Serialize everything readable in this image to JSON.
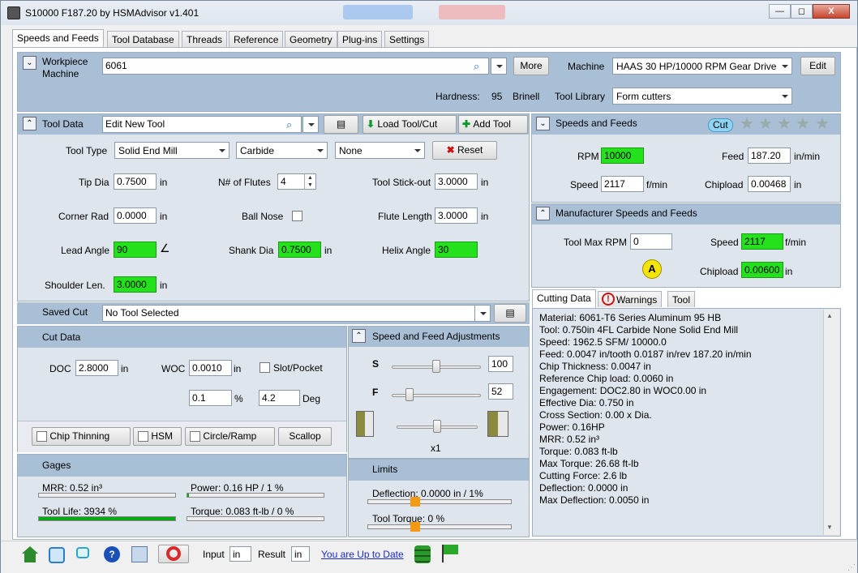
{
  "window": {
    "title": "S10000 F187.20 by HSMAdvisor v1.401",
    "min": "—",
    "restore": "◻",
    "close": "X"
  },
  "tabs": [
    "Speeds and Feeds",
    "Tool Database",
    "Threads",
    "Reference",
    "Geometry",
    "Plug-ins",
    "Settings"
  ],
  "workpiece": {
    "label1": "Workpiece",
    "label2": "Machine",
    "material": "6061",
    "more": "More",
    "machine_label": "Machine",
    "machine_value": "HAAS 30 HP/10000 RPM Gear Drive",
    "edit": "Edit",
    "hardness_label": "Hardness:",
    "hardness_value": "95",
    "hardness_unit": "Brinell",
    "tool_library_label": "Tool Library",
    "tool_library_value": "Form cutters"
  },
  "tool_data": {
    "header": "Tool Data",
    "tool_name": "Edit New Tool",
    "load": "Load Tool/Cut",
    "add": "Add Tool",
    "tool_type_label": "Tool Type",
    "tool_type": "Solid End Mill",
    "material": "Carbide",
    "coating": "None",
    "reset": "Reset",
    "tip_dia_label": "Tip Dia",
    "tip_dia": "0.7500",
    "flutes_label": "N# of Flutes",
    "flutes": "4",
    "stickout_label": "Tool Stick-out",
    "stickout": "3.0000",
    "corner_label": "Corner Rad",
    "corner": "0.0000",
    "ballnose_label": "Ball Nose",
    "flute_len_label": "Flute Length",
    "flute_len": "3.0000",
    "lead_label": "Lead Angle",
    "lead": "90",
    "shank_label": "Shank Dia",
    "shank": "0.7500",
    "helix_label": "Helix Angle",
    "helix": "30",
    "shoulder_label": "Shoulder Len.",
    "shoulder": "3.0000",
    "unit": "in"
  },
  "saved_cut": {
    "label": "Saved Cut",
    "value": "No Tool Selected"
  },
  "cut_data": {
    "header": "Cut Data",
    "doc_label": "DOC",
    "doc": "2.8000",
    "woc_label": "WOC",
    "woc": "0.0010",
    "slot": "Slot/Pocket",
    "pct": "0.1",
    "pct_unit": "%",
    "deg": "4.2",
    "deg_unit": "Deg",
    "unit": "in"
  },
  "buttons": {
    "chip": "Chip Thinning",
    "hsm": "HSM",
    "circle": "Circle/Ramp",
    "scallop": "Scallop"
  },
  "adjust": {
    "header": "Speed and Feed Adjustments",
    "s": "S",
    "s_val": "100",
    "f": "F",
    "f_val": "52",
    "mult": "x1",
    "s_pos": 0.5,
    "f_pos": 0.2,
    "m_pos": 0.5
  },
  "gages": {
    "header": "Gages",
    "mrr": "MRR: 0.52 in³",
    "power": "Power: 0.16 HP / 1 %",
    "life": "Tool Life: 3934 %",
    "torque": "Torque: 0.083 ft-lb / 0 %",
    "mrr_level": 0.0,
    "power_level": 0.01,
    "life_level": 1.0,
    "torque_level": 0.0
  },
  "limits": {
    "header": "Limits",
    "deflection": "Deflection: 0.0000 in / 1%",
    "tool_torque": "Tool Torque: 0 %",
    "deflection_level": 0.33,
    "torque_level": 0.33
  },
  "sf": {
    "header": "Speeds and Feeds",
    "cut": "Cut",
    "rpm_label": "RPM",
    "rpm": "10000",
    "feed_label": "Feed",
    "feed": "187.20",
    "feed_unit": "in/min",
    "speed_label": "Speed",
    "speed": "2117",
    "speed_unit": "f/min",
    "chip_label": "Chipload",
    "chip": "0.00468",
    "chip_unit": "in"
  },
  "mfr": {
    "header": "Manufacturer Speeds and Feeds",
    "max_rpm_label": "Tool Max RPM",
    "max_rpm": "0",
    "speed_label": "Speed",
    "speed": "2117",
    "speed_unit": "f/min",
    "chip_label": "Chipload",
    "chip": "0.00600",
    "chip_unit": "in",
    "badge": "A"
  },
  "cd_tabs": [
    "Cutting Data",
    "Warnings",
    "Tool"
  ],
  "cutting_data": [
    "Material: 6061-T6 Series Aluminum 95 HB",
    "Tool: 0.750in 4FL Carbide None Solid End Mill",
    "Speed: 1962.5 SFM/ 10000.0",
    "Feed: 0.0047 in/tooth 0.0187 in/rev 187.20 in/min",
    "Chip Thickness: 0.0047 in",
    "Reference Chip load: 0.0060 in",
    "Engagement: DOC2.80 in  WOC0.00 in",
    "Effective Dia: 0.750 in",
    "Cross Section: 0.00 x Dia.",
    "Power: 0.16HP",
    "MRR: 0.52 in³",
    "Torque: 0.083 ft-lb",
    "Max Torque: 26.68 ft-lb",
    "Cutting Force: 2.6 lb",
    "Deflection: 0.0000 in",
    "Max Deflection: 0.0050 in"
  ],
  "status": {
    "input_label": "Input",
    "input": "in",
    "result_label": "Result",
    "result": "in",
    "update": "You are Up to Date"
  },
  "colors": {
    "green": "#23e21c",
    "header": "#a9bfd6",
    "gauge": "#07a81a",
    "orange": "#f39a14"
  }
}
